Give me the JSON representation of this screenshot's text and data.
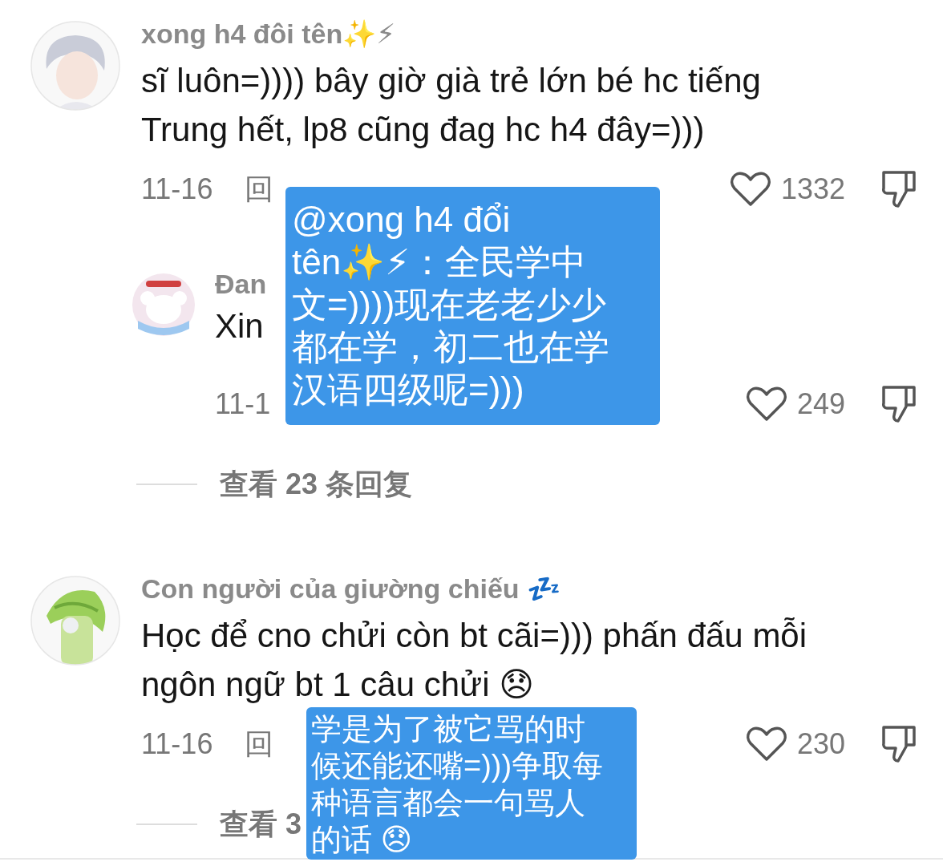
{
  "comments": [
    {
      "author": "xong h4 đôi tên✨⚡",
      "text": "sĩ luôn=)))) bây giờ già trẻ lớn bé hc tiếng Trung hết, lp8 cũng đag hc h4 đây=)))",
      "date": "11-16",
      "reply_label": "回",
      "likes": "1332",
      "liked": false,
      "replies": [
        {
          "author": "Đan",
          "text": "Xin",
          "date": "11-1",
          "likes": "249",
          "liked": false
        }
      ],
      "view_replies": "查看 23 条回复"
    },
    {
      "author": "Con người của giường chiếu 💤",
      "text": "Học để cno chửi còn bt cãi=))) phấn đấu mỗi ngôn ngữ bt 1 câu chửi 😞",
      "date": "11-16",
      "reply_label": "回",
      "likes": "230",
      "liked": false,
      "view_replies": "查看 3"
    }
  ],
  "translations": [
    {
      "text": "@xong h4 đổi tên✨⚡：全民学中文=))))现在老老少少都在学，初二也在学汉语四级呢=)))"
    },
    {
      "text": "学是为了被它骂的时候还能还嘴=)))争取每种语言都会一句骂人的话 😞"
    }
  ]
}
